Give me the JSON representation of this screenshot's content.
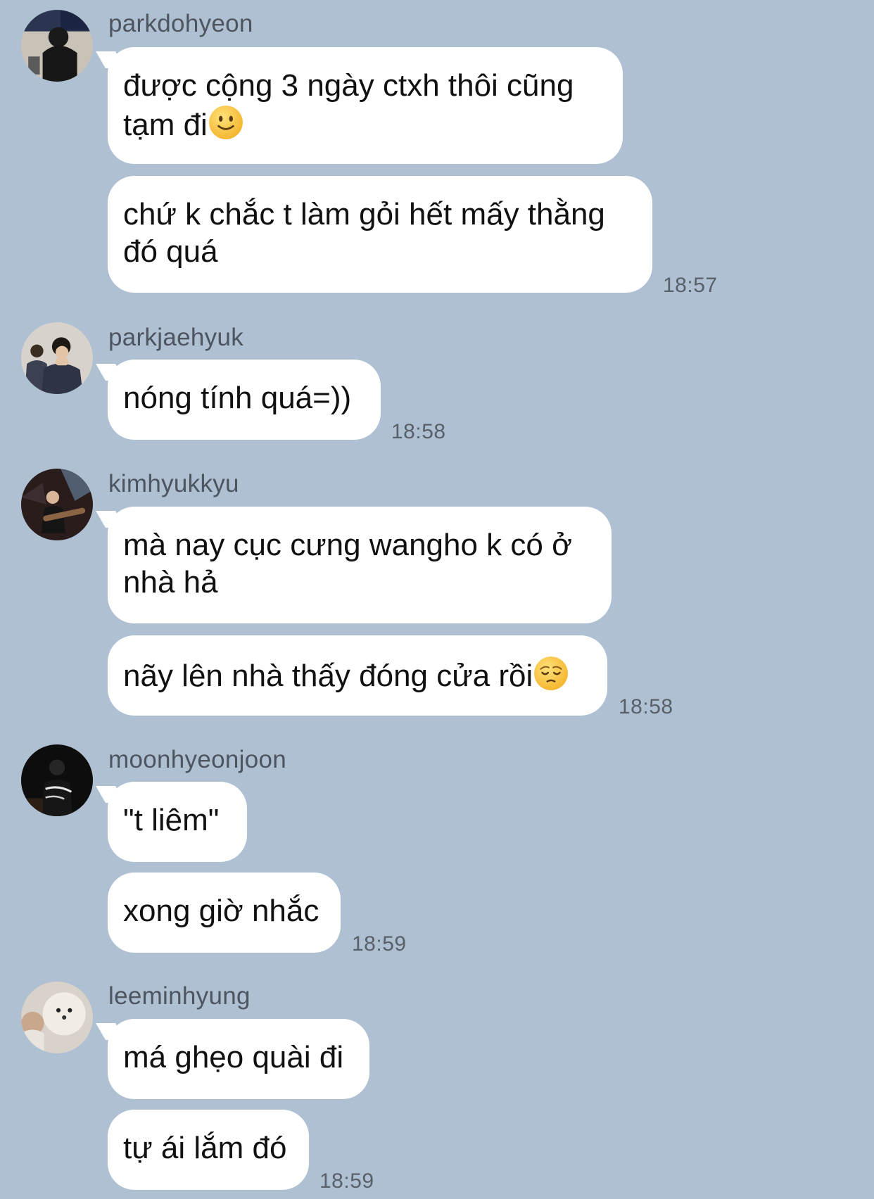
{
  "messages": [
    {
      "sender": "parkdohyeon",
      "bubbles": [
        {
          "line1": "được cộng 3 ngày ctxh thôi cũng",
          "line2": "tạm đi",
          "emoji": "slightly-smiling-face-icon"
        },
        {
          "line1": "chứ k chắc t làm gỏi hết mấy thằng",
          "line2": "đó quá"
        }
      ],
      "time": "18:57"
    },
    {
      "sender": "parkjaehyuk",
      "bubbles": [
        {
          "text": "nóng tính quá=))"
        }
      ],
      "time": "18:58"
    },
    {
      "sender": "kimhyukkyu",
      "bubbles": [
        {
          "line1": "mà nay cục cưng wangho k có ở",
          "line2": "nhà hả"
        },
        {
          "text": "nãy lên nhà thấy đóng cửa rồi",
          "emoji": "pensive-face-icon"
        }
      ],
      "time": "18:58"
    },
    {
      "sender": "moonhyeonjoon",
      "bubbles": [
        {
          "text": "\"t liêm\""
        },
        {
          "text": "xong giờ nhắc"
        }
      ],
      "time": "18:59"
    },
    {
      "sender": "leeminhyung",
      "bubbles": [
        {
          "text": "má ghẹo quài đi"
        },
        {
          "text": "tự ái lắm đó"
        }
      ],
      "time": "18:59"
    }
  ],
  "colors": {
    "background": "#aec0d1",
    "bubble": "#ffffff",
    "sender_text": "#4d5560",
    "time_text": "#58606a"
  }
}
